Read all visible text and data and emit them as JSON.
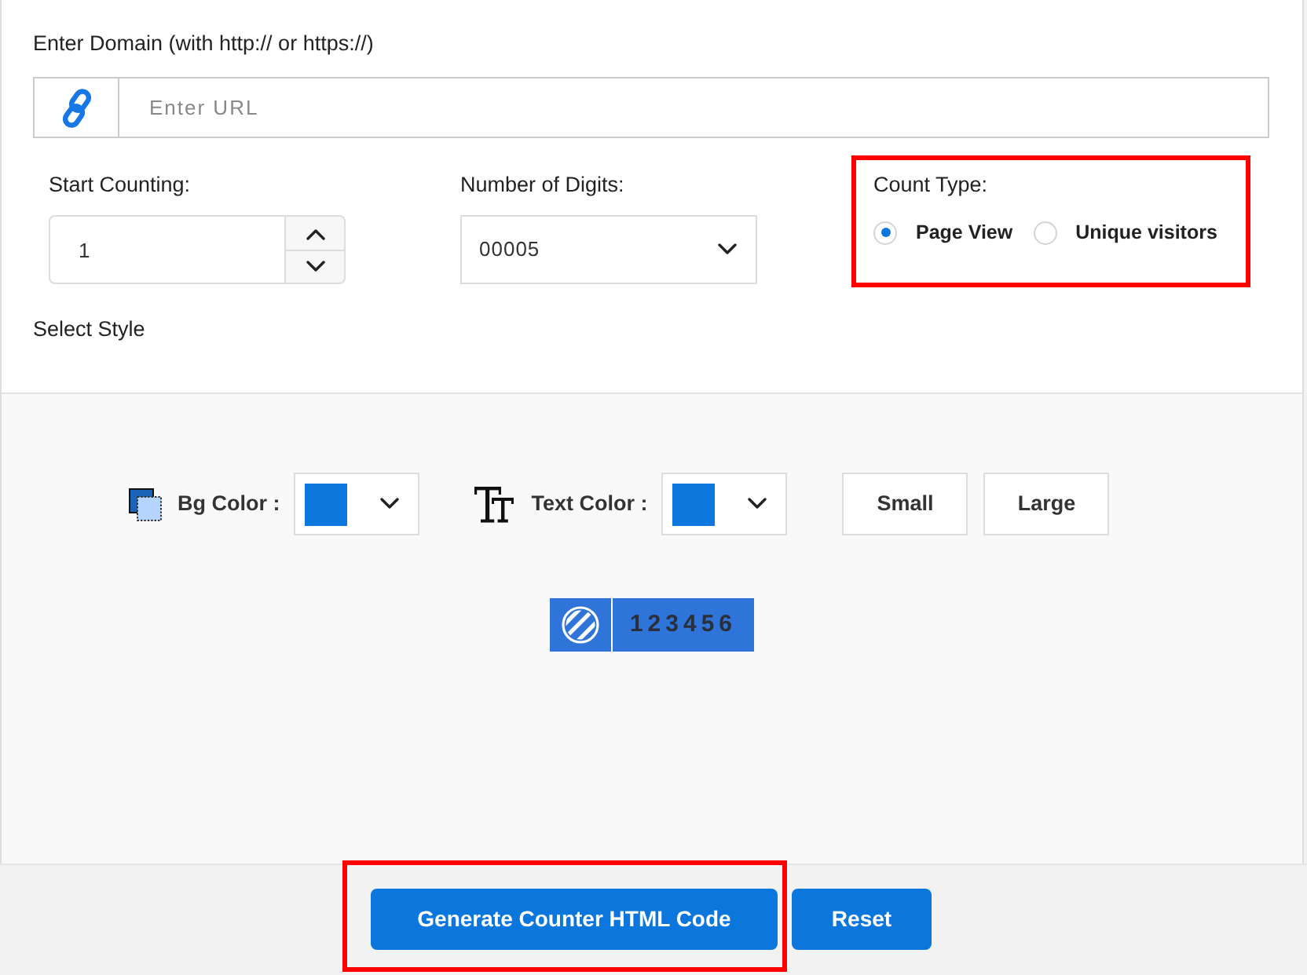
{
  "domain": {
    "label": "Enter Domain (with http:// or https://)",
    "placeholder": "Enter URL"
  },
  "start_counting": {
    "label": "Start Counting:",
    "value": "1"
  },
  "number_of_digits": {
    "label": "Number of Digits:",
    "value": "00005"
  },
  "count_type": {
    "label": "Count Type:",
    "highlighted": true,
    "options": [
      {
        "label": "Page View",
        "selected": true
      },
      {
        "label": "Unique visitors",
        "selected": false
      }
    ]
  },
  "select_style": {
    "label": "Select Style"
  },
  "style": {
    "bg_color": {
      "label": "Bg Color :",
      "color": "#0c77dc"
    },
    "text_color": {
      "label": "Text Color :",
      "color": "#0c77dc"
    },
    "sizes": [
      {
        "label": "Small",
        "selected": false
      },
      {
        "label": "Large",
        "selected": false
      }
    ]
  },
  "preview": {
    "digits": "123456"
  },
  "buttons": [
    {
      "label": "Generate Counter HTML Code",
      "highlighted": true
    },
    {
      "label": "Reset",
      "highlighted": false
    }
  ]
}
